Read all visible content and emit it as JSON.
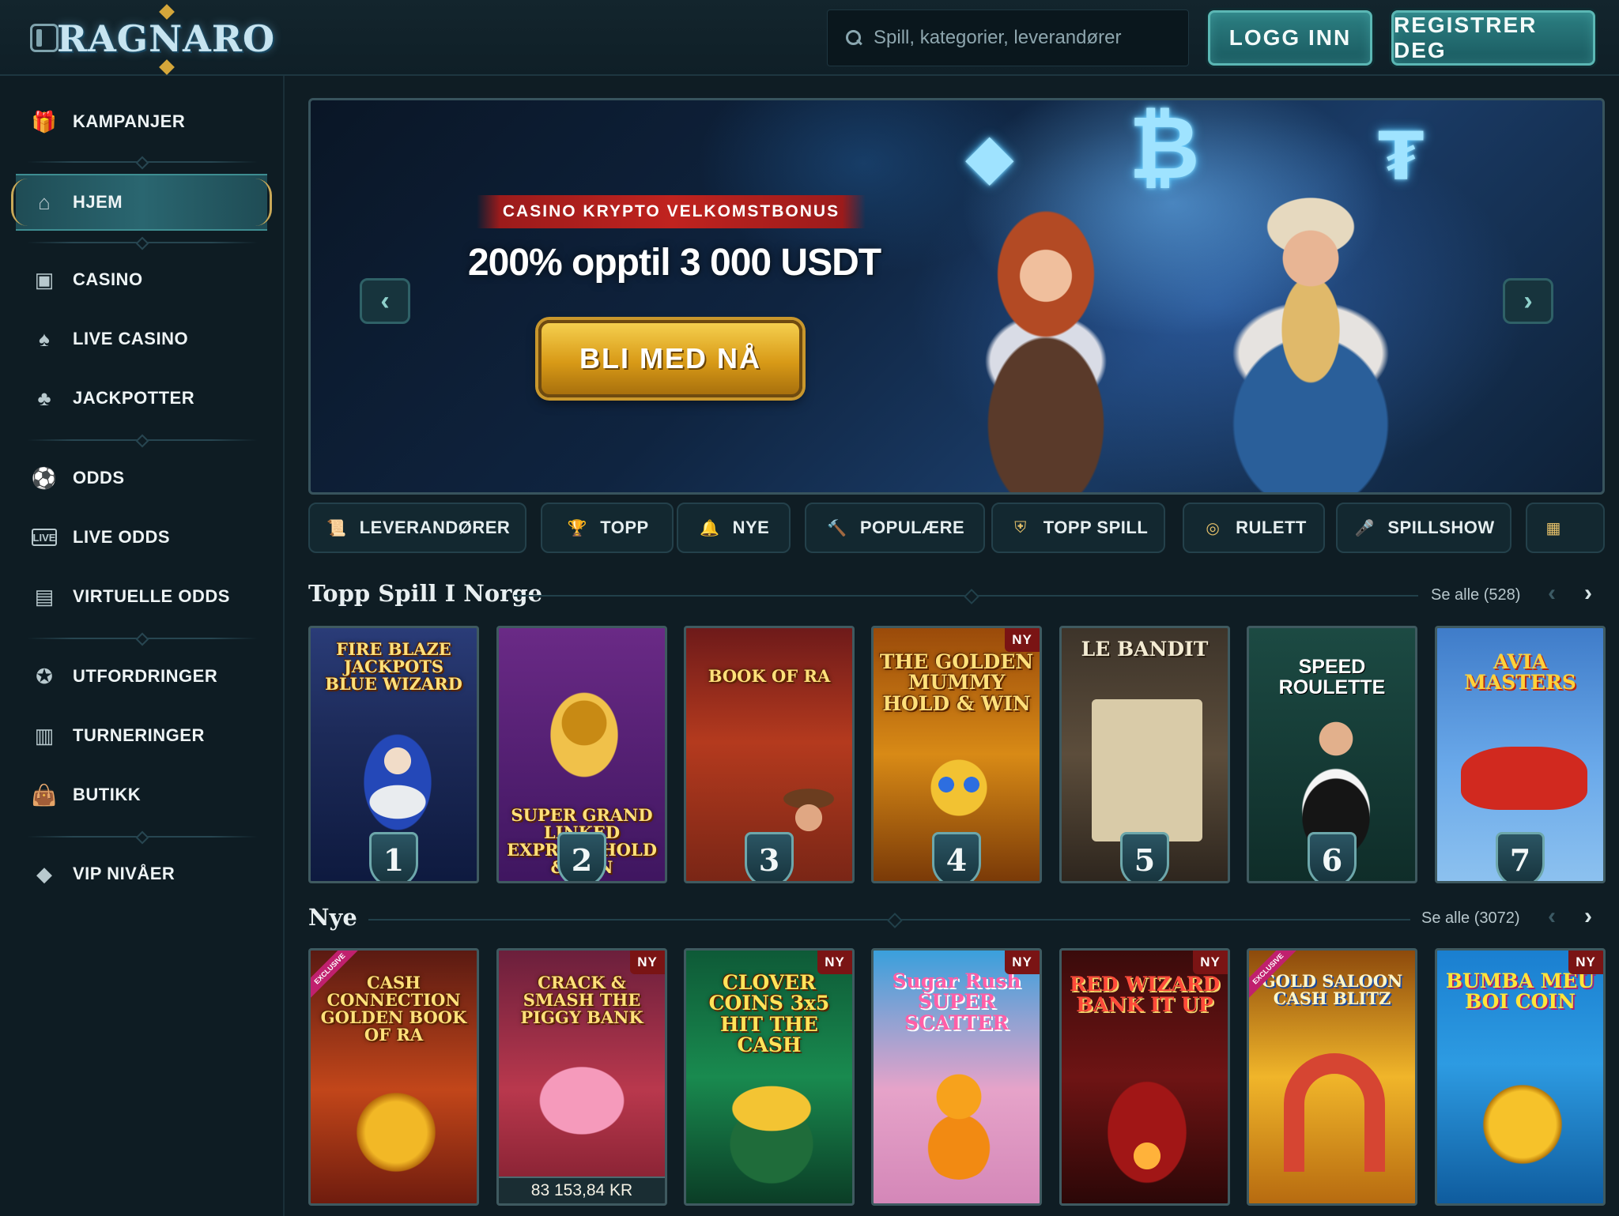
{
  "header": {
    "logo_text": "RAGNARO",
    "search_placeholder": "Spill, kategorier, leverandører",
    "login_label": "LOGG INN",
    "register_label": "REGISTRER DEG"
  },
  "sidebar": {
    "items": [
      {
        "label": "KAMPANJER",
        "icon": "gift-icon"
      },
      {
        "label": "HJEM",
        "icon": "home-icon",
        "active": true
      },
      {
        "label": "CASINO",
        "icon": "slot-machine-icon"
      },
      {
        "label": "LIVE CASINO",
        "icon": "card-icon"
      },
      {
        "label": "JACKPOTTER",
        "icon": "clover-icon"
      },
      {
        "label": "ODDS",
        "icon": "soccer-ball-icon"
      },
      {
        "label": "LIVE ODDS",
        "icon": "live-icon"
      },
      {
        "label": "VIRTUELLE ODDS",
        "icon": "virtual-screen-icon"
      },
      {
        "label": "UTFORDRINGER",
        "icon": "medal-icon"
      },
      {
        "label": "TURNERINGER",
        "icon": "podium-icon"
      },
      {
        "label": "BUTIKK",
        "icon": "shopping-bag-icon"
      },
      {
        "label": "VIP NIVÅER",
        "icon": "diamond-icon"
      }
    ]
  },
  "banner": {
    "tag": "CASINO KRYPTO VELKOMSTBONUS",
    "headline": "200% opptil 3 000 USDT",
    "cta_label": "BLI MED NÅ"
  },
  "categories": [
    {
      "label": "LEVERANDØRER",
      "icon": "scroll-icon"
    },
    {
      "label": "TOPP",
      "icon": "trophy-icon"
    },
    {
      "label": "NYE",
      "icon": "bell-icon"
    },
    {
      "label": "POPULÆRE",
      "icon": "hammer-icon"
    },
    {
      "label": "TOPP SPILL",
      "icon": "shield-icon"
    },
    {
      "label": "RULETT",
      "icon": "roulette-icon"
    },
    {
      "label": "SPILLSHOW",
      "icon": "microphone-icon"
    }
  ],
  "top_games": {
    "title": "Topp Spill I Norge",
    "see_all": "Se alle (528)",
    "games": [
      {
        "title": "FIRE BLAZE JACKPOTS BLUE WIZARD",
        "rank": "1"
      },
      {
        "title": "SUPER GRAND LINKED EXPRESS HOLD & WIN",
        "rank": "2"
      },
      {
        "title": "BOOK OF RA",
        "rank": "3"
      },
      {
        "title": "THE GOLDEN MUMMY HOLD & WIN",
        "rank": "4",
        "badge": "NY"
      },
      {
        "title": "LE BANDIT",
        "rank": "5"
      },
      {
        "title": "SPEED ROULETTE",
        "rank": "6"
      },
      {
        "title": "AVIA MASTERS",
        "rank": "7"
      }
    ]
  },
  "new_games": {
    "title": "Nye",
    "see_all": "Se alle (3072)",
    "games": [
      {
        "title": "CASH CONNECTION GOLDEN BOOK OF RA",
        "exclusive": "EXCLUSIVE"
      },
      {
        "title": "CRACK & SMASH THE PIGGY BANK",
        "badge": "NY",
        "jackpot": "83 153,84 KR"
      },
      {
        "title": "CLOVER COINS 3x5 HIT THE CASH",
        "badge": "NY"
      },
      {
        "title": "Sugar Rush SUPER SCATTER",
        "badge": "NY"
      },
      {
        "title": "RED WIZARD BANK IT UP",
        "badge": "NY"
      },
      {
        "title": "GOLD SALOON CASH BLITZ",
        "exclusive": "EXCLUSIVE"
      },
      {
        "title": "BUMBA MEU BOI COIN",
        "badge": "NY"
      }
    ]
  }
}
